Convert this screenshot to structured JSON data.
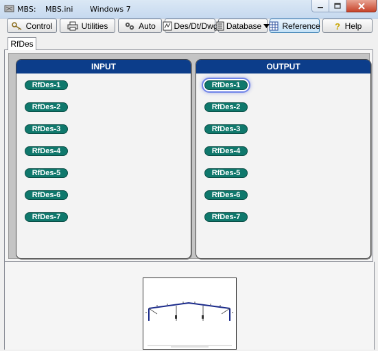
{
  "window": {
    "title_parts": [
      "MBS:",
      "MBS.ini",
      "Windows 7"
    ],
    "controls": [
      "minimize",
      "maximize",
      "close"
    ]
  },
  "toolbar": {
    "buttons": [
      {
        "label": "Control",
        "icon": "key-icon"
      },
      {
        "label": "Utilities",
        "icon": "printer-icon"
      },
      {
        "label": "Auto",
        "icon": "gears-icon"
      },
      {
        "label": "Des/Dt/Dwg",
        "icon": "drawing-icon"
      },
      {
        "label": "Database",
        "icon": "database-icon",
        "dropdown": true
      },
      {
        "label": "Reference",
        "icon": "reference-icon",
        "active": true
      },
      {
        "label": "Help",
        "icon": "question-icon"
      }
    ]
  },
  "tabs": [
    {
      "label": "RfDes",
      "selected": true
    }
  ],
  "input_panel": {
    "title": "INPUT",
    "buttons": [
      "RfDes-1",
      "RfDes-2",
      "RfDes-3",
      "RfDes-4",
      "RfDes-5",
      "RfDes-6",
      "RfDes-7"
    ]
  },
  "output_panel": {
    "title": "OUTPUT",
    "buttons": [
      "RfDes-1",
      "RfDes-2",
      "RfDes-3",
      "RfDes-4",
      "RfDes-5",
      "RfDes-6",
      "RfDes-7"
    ],
    "focused_index": 0
  },
  "preview": {
    "icon": "frame-structure-icon"
  },
  "colors": {
    "panel_header": "#0c3d8a",
    "pill": "#0f786c",
    "focus_ring": "#6f83e8"
  }
}
